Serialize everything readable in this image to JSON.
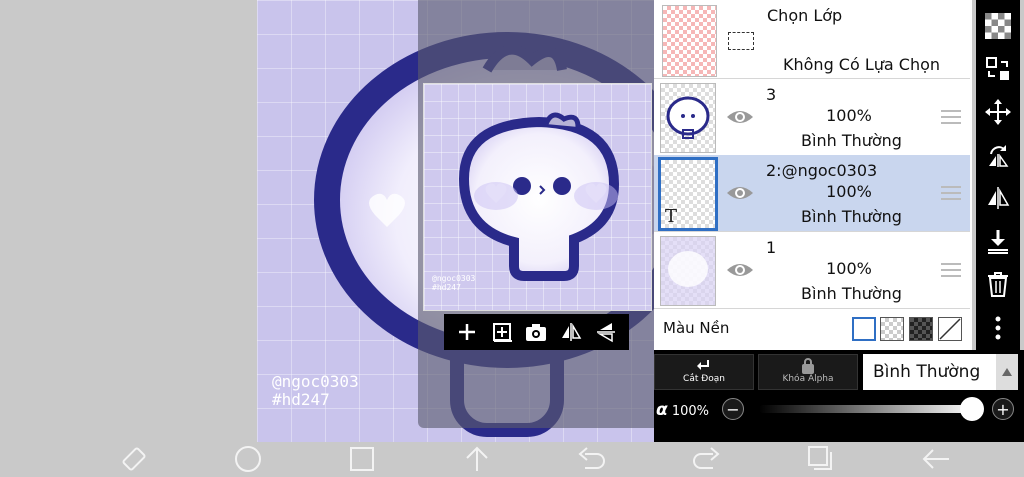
{
  "canvas": {
    "watermark_line1": "@ngoc0303",
    "watermark_line2": "#hd247"
  },
  "preview": {
    "watermark_line1": "@ngoc0303",
    "watermark_line2": "#hd247",
    "toolbar": [
      "plus-icon",
      "add-layer-icon",
      "camera-icon",
      "flip-horizontal-icon",
      "flip-vertical-icon"
    ]
  },
  "selection_row": {
    "title": "Chọn Lớp",
    "status": "Không Có Lựa Chọn"
  },
  "layers": [
    {
      "name": "3",
      "opacity": "100%",
      "blend": "Bình Thường",
      "selected": false
    },
    {
      "name": "2:@ngoc0303",
      "opacity": "100%",
      "blend": "Bình Thường",
      "selected": true
    },
    {
      "name": "1",
      "opacity": "100%",
      "blend": "Bình Thường",
      "selected": false
    }
  ],
  "background": {
    "label": "Màu Nền",
    "options": [
      "white",
      "checker-light",
      "checker-dark",
      "none"
    ],
    "selected": "white"
  },
  "controls": {
    "clip_label": "Cắt Đoạn",
    "alpha_lock_label": "Khóa Alpha",
    "blend_mode": "Bình Thường",
    "alpha_symbol": "α",
    "alpha_value": "100%",
    "alpha_fraction": 1.0
  },
  "right_toolbar": [
    "checker-icon",
    "transform-icon",
    "move-icon",
    "rotate-icon",
    "flip-horizontal-icon",
    "flip-vertical-icon",
    "merge-down-icon",
    "trash-icon",
    "more-icon"
  ],
  "navbar": [
    "rotate-screen-icon",
    "home-icon",
    "recents-icon",
    "up-arrow-icon",
    "undo-icon",
    "redo-icon",
    "layers-icon",
    "back-icon"
  ],
  "colors": {
    "accent": "#2f6fc4",
    "art_outline": "#2a2a8a",
    "canvas_bg": "#c9c4ec"
  }
}
